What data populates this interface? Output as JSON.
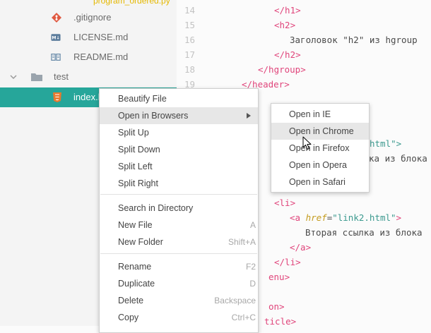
{
  "file_tree": {
    "items": [
      {
        "label": "program_ordered.py",
        "icon": "python-file-icon"
      },
      {
        "label": ".gitignore",
        "icon": "git-icon"
      },
      {
        "label": "LICENSE.md",
        "icon": "markdown-icon"
      },
      {
        "label": "README.md",
        "icon": "readme-icon"
      },
      {
        "label": "test",
        "icon": "folder-icon"
      },
      {
        "label": "index.h",
        "icon": "html5-icon"
      }
    ]
  },
  "editor": {
    "line_numbers": [
      "14",
      "15",
      "16",
      "17",
      "18",
      "19"
    ],
    "tokens": {
      "l14": "</h1>",
      "l15": "<h2>",
      "l16": "Заголовок \"h2\" из hgroup",
      "l17": "</h2>",
      "l18": "</hgroup>",
      "l19": "</header>",
      "a_html_frag": "html\">",
      "ka_frag": "ка из блока",
      "li_open": "<li>",
      "a_open": "<a",
      "href_attr": "href",
      "eq": "=",
      "href_val": "\"link2.html\"",
      "gt": ">",
      "link2_text": "Вторая ссылка из блока",
      "a_close": "</a>",
      "li_close": "</li>",
      "enu_frag": "enu>",
      "on_frag": "on>",
      "ticle_frag": "ticle>"
    }
  },
  "context_menu": {
    "items": [
      {
        "label": "Beautify File",
        "shortcut": ""
      },
      {
        "label": "Open in Browsers",
        "shortcut": ""
      },
      {
        "label": "Split Up",
        "shortcut": ""
      },
      {
        "label": "Split Down",
        "shortcut": ""
      },
      {
        "label": "Split Left",
        "shortcut": ""
      },
      {
        "label": "Split Right",
        "shortcut": ""
      },
      {
        "label": "Search in Directory",
        "shortcut": ""
      },
      {
        "label": "New File",
        "shortcut": "A"
      },
      {
        "label": "New Folder",
        "shortcut": "Shift+A"
      },
      {
        "label": "Rename",
        "shortcut": "F2"
      },
      {
        "label": "Duplicate",
        "shortcut": "D"
      },
      {
        "label": "Delete",
        "shortcut": "Backspace"
      },
      {
        "label": "Copy",
        "shortcut": "Ctrl+C"
      }
    ],
    "highlighted": "Open in Browsers"
  },
  "submenu": {
    "items": [
      {
        "label": "Open in IE"
      },
      {
        "label": "Open in Chrome"
      },
      {
        "label": "Open in Firefox"
      },
      {
        "label": "Open in Opera"
      },
      {
        "label": "Open in Safari"
      }
    ],
    "highlighted": "Open in Chrome"
  },
  "colors": {
    "selection": "#26a69a",
    "tag": "#e0457b",
    "attribute": "#c39a1c",
    "string": "#3c9a8f",
    "menu_highlight": "#e7e7e7"
  }
}
